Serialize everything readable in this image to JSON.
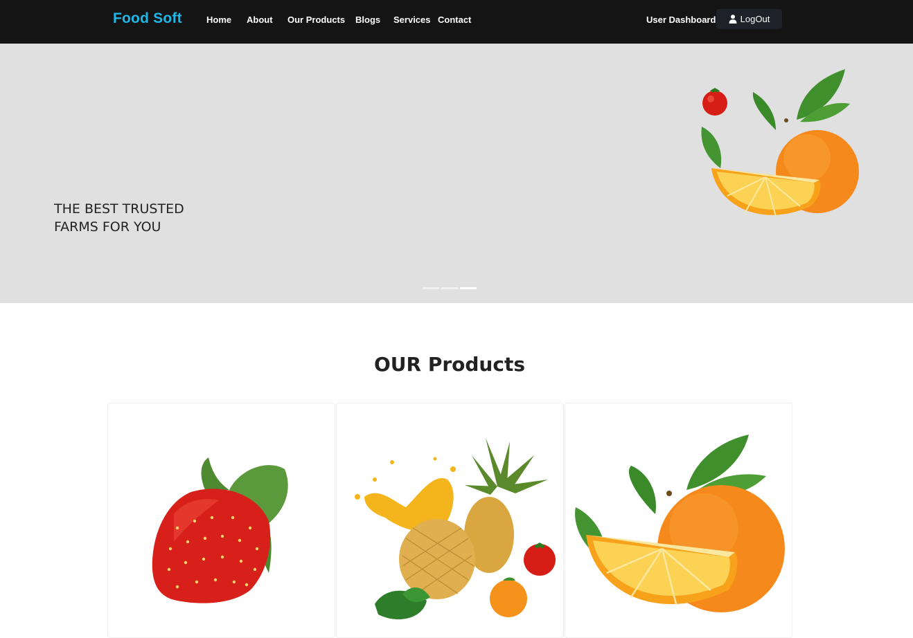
{
  "navbar": {
    "brand": "Food Soft",
    "links": [
      {
        "label": "Home"
      },
      {
        "label": "About"
      },
      {
        "label": "Our Products"
      },
      {
        "label": "Blogs"
      },
      {
        "label": "Services"
      },
      {
        "label": "Contact"
      }
    ],
    "dashboard_label": "User Dashboard",
    "logout_label": "LogOut",
    "logout_icon": "user-icon"
  },
  "hero": {
    "caption_line1": "THE BEST TRUSTED",
    "caption_line2": "FARMS FOR YOU",
    "image": "orange-and-tomato",
    "slide_count": 3,
    "active_slide": 3
  },
  "products": {
    "title": "OUR Products",
    "cards": [
      {
        "image": "strawberry"
      },
      {
        "image": "pineapple-juice-splash"
      },
      {
        "image": "orange-with-leaves"
      }
    ]
  },
  "colors": {
    "navbar_bg": "#141414",
    "brand": "#1eb8e8",
    "hero_bg": "#e0e0e0",
    "logout_bg": "#1e2128"
  }
}
